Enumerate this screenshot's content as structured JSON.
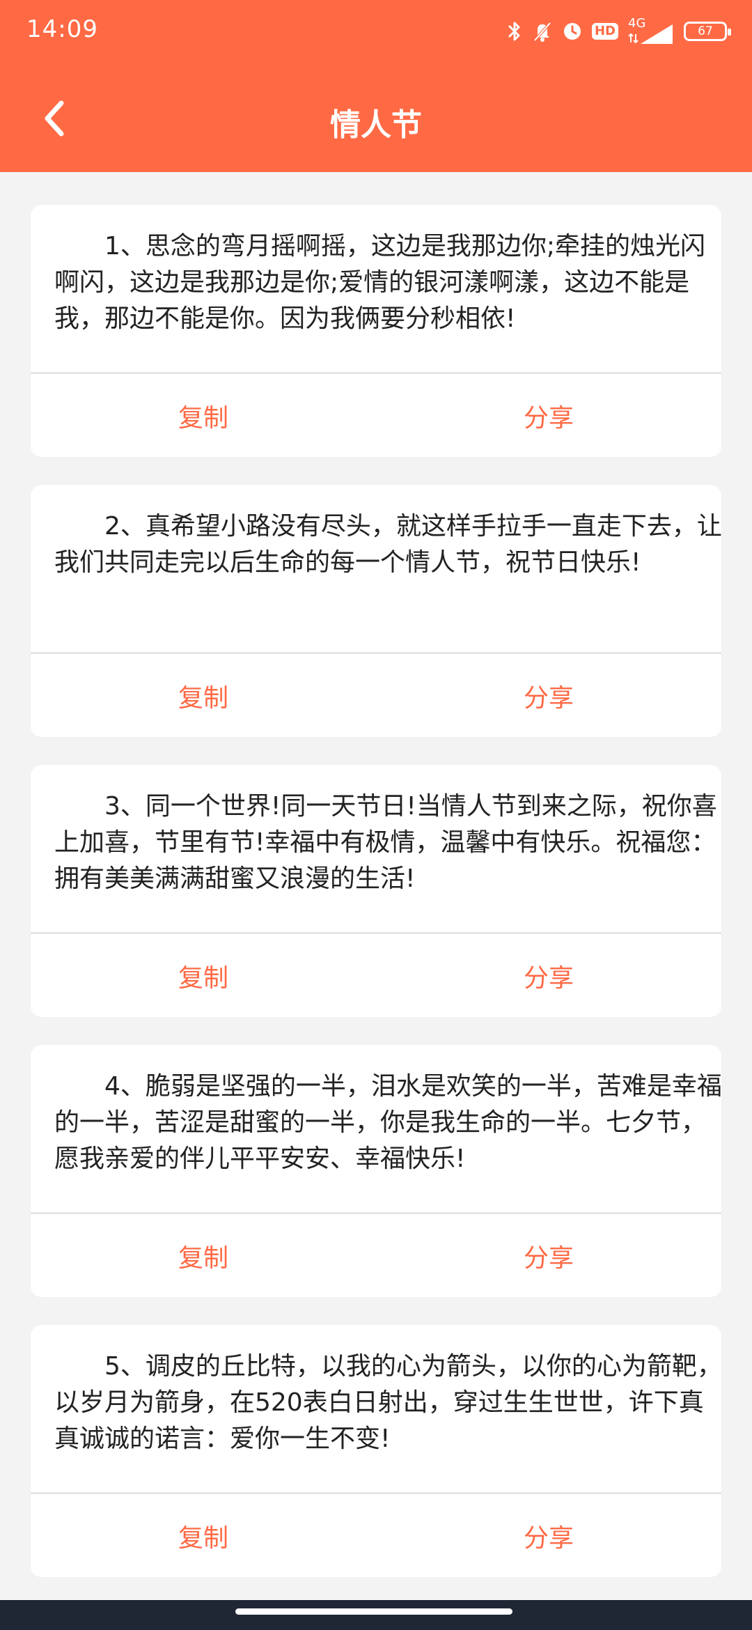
{
  "status_bar": {
    "time": "14:09",
    "icons": [
      "bluetooth-icon",
      "mute-icon",
      "alarm-icon",
      "hd-icon",
      "4g-signal-icon",
      "battery-icon"
    ],
    "hd": "HD",
    "network": "4G",
    "battery": "67"
  },
  "header": {
    "title": "情人节",
    "back_icon": "chevron-left-icon"
  },
  "cards": [
    {
      "text": "1、思念的弯月摇啊摇，这边是我那边你;牵挂的烛光闪啊闪，这边是我那边是你;爱情的银河漾啊漾，这边不能是我，那边不能是你。因为我俩要分秒相依!",
      "copy": "复制",
      "share": "分享"
    },
    {
      "text": "2、真希望小路没有尽头，就这样手拉手一直走下去，让我们共同走完以后生命的每一个情人节，祝节日快乐!",
      "copy": "复制",
      "share": "分享"
    },
    {
      "text": "3、同一个世界!同一天节日!当情人节到来之际，祝你喜上加喜，节里有节!幸福中有极情，温馨中有快乐。祝福您：拥有美美满满甜蜜又浪漫的生活!",
      "copy": "复制",
      "share": "分享"
    },
    {
      "text": "4、脆弱是坚强的一半，泪水是欢笑的一半，苦难是幸福的一半，苦涩是甜蜜的一半，你是我生命的一半。七夕节，愿我亲爱的伴儿平平安安、幸福快乐!",
      "copy": "复制",
      "share": "分享"
    },
    {
      "text": "5、调皮的丘比特，以我的心为箭头，以你的心为箭靶，以岁月为箭身，在520表白日射出，穿过生生世世，许下真真诚诚的诺言：爱你一生不变!",
      "copy": "复制",
      "share": "分享"
    }
  ],
  "colors": {
    "accent": "#ff6a45",
    "background": "#f3f3f3",
    "card": "#ffffff",
    "text": "#222222",
    "nav_bar": "#1f2634"
  }
}
